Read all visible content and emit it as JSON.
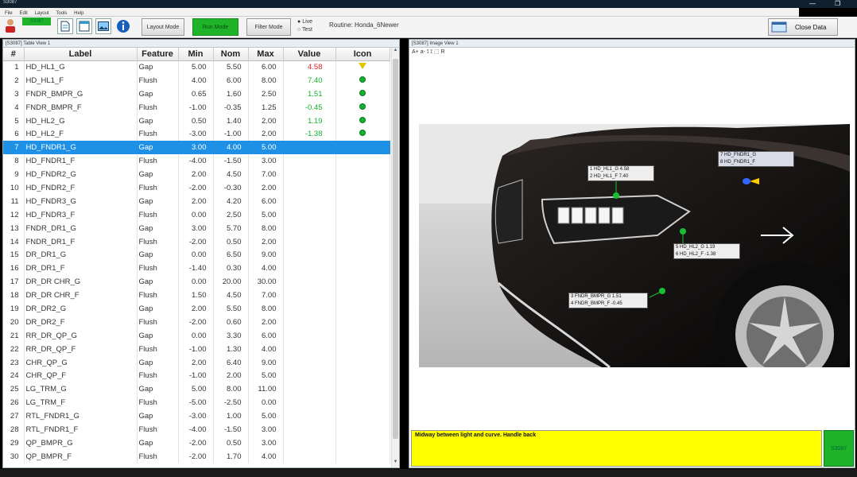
{
  "window": {
    "title": "S3087",
    "menu": [
      "File",
      "Edit",
      "Layout",
      "Tools",
      "Help"
    ]
  },
  "toolbar": {
    "id_badge": "S3087",
    "layout_mode": "Layout Mode",
    "run_mode": "Run Mode",
    "filter_mode": "Filter Mode",
    "radio_live": "Live",
    "radio_test": "Test",
    "routine": "Routine: Honda_6Newer",
    "close_data": "Close Data"
  },
  "table_view": {
    "title": "[S3087] Table View 1",
    "columns": [
      "#",
      "Label",
      "Feature",
      "Min",
      "Nom",
      "Max",
      "Value",
      "Icon"
    ],
    "rows": [
      {
        "n": "1",
        "label": "HD_HL1_G",
        "feature": "Gap",
        "min": "5.00",
        "nom": "5.50",
        "max": "6.00",
        "value": "4.58",
        "value_color": "#e02020",
        "icon": "warn"
      },
      {
        "n": "2",
        "label": "HD_HL1_F",
        "feature": "Flush",
        "min": "4.00",
        "nom": "6.00",
        "max": "8.00",
        "value": "7.40",
        "value_color": "#13b52b",
        "icon": "ok"
      },
      {
        "n": "3",
        "label": "FNDR_BMPR_G",
        "feature": "Gap",
        "min": "0.65",
        "nom": "1.60",
        "max": "2.50",
        "value": "1.51",
        "value_color": "#13b52b",
        "icon": "ok"
      },
      {
        "n": "4",
        "label": "FNDR_BMPR_F",
        "feature": "Flush",
        "min": "-1.00",
        "nom": "-0.35",
        "max": "1.25",
        "value": "-0.45",
        "value_color": "#13b52b",
        "icon": "ok"
      },
      {
        "n": "5",
        "label": "HD_HL2_G",
        "feature": "Gap",
        "min": "0.50",
        "nom": "1.40",
        "max": "2.00",
        "value": "1.19",
        "value_color": "#13b52b",
        "icon": "ok"
      },
      {
        "n": "6",
        "label": "HD_HL2_F",
        "feature": "Flush",
        "min": "-3.00",
        "nom": "-1.00",
        "max": "2.00",
        "value": "-1.38",
        "value_color": "#13b52b",
        "icon": "ok"
      },
      {
        "n": "7",
        "label": "HD_FNDR1_G",
        "feature": "Gap",
        "min": "3.00",
        "nom": "4.00",
        "max": "5.00",
        "value": "",
        "value_color": "",
        "icon": "",
        "selected": true
      },
      {
        "n": "8",
        "label": "HD_FNDR1_F",
        "feature": "Flush",
        "min": "-4.00",
        "nom": "-1.50",
        "max": "3.00",
        "value": "",
        "value_color": "",
        "icon": ""
      },
      {
        "n": "9",
        "label": "HD_FNDR2_G",
        "feature": "Gap",
        "min": "2.00",
        "nom": "4.50",
        "max": "7.00",
        "value": "",
        "value_color": "",
        "icon": ""
      },
      {
        "n": "10",
        "label": "HD_FNDR2_F",
        "feature": "Flush",
        "min": "-2.00",
        "nom": "-0.30",
        "max": "2.00",
        "value": "",
        "value_color": "",
        "icon": ""
      },
      {
        "n": "11",
        "label": "HD_FNDR3_G",
        "feature": "Gap",
        "min": "2.00",
        "nom": "4.20",
        "max": "6.00",
        "value": "",
        "value_color": "",
        "icon": ""
      },
      {
        "n": "12",
        "label": "HD_FNDR3_F",
        "feature": "Flush",
        "min": "0.00",
        "nom": "2.50",
        "max": "5.00",
        "value": "",
        "value_color": "",
        "icon": ""
      },
      {
        "n": "13",
        "label": "FNDR_DR1_G",
        "feature": "Gap",
        "min": "3.00",
        "nom": "5.70",
        "max": "8.00",
        "value": "",
        "value_color": "",
        "icon": ""
      },
      {
        "n": "14",
        "label": "FNDR_DR1_F",
        "feature": "Flush",
        "min": "-2.00",
        "nom": "0.50",
        "max": "2.00",
        "value": "",
        "value_color": "",
        "icon": ""
      },
      {
        "n": "15",
        "label": "DR_DR1_G",
        "feature": "Gap",
        "min": "0.00",
        "nom": "6.50",
        "max": "9.00",
        "value": "",
        "value_color": "",
        "icon": ""
      },
      {
        "n": "16",
        "label": "DR_DR1_F",
        "feature": "Flush",
        "min": "-1.40",
        "nom": "0.30",
        "max": "4.00",
        "value": "",
        "value_color": "",
        "icon": ""
      },
      {
        "n": "17",
        "label": "DR_DR CHR_G",
        "feature": "Gap",
        "min": "0.00",
        "nom": "20.00",
        "max": "30.00",
        "value": "",
        "value_color": "",
        "icon": ""
      },
      {
        "n": "18",
        "label": "DR_DR CHR_F",
        "feature": "Flush",
        "min": "1.50",
        "nom": "4.50",
        "max": "7.00",
        "value": "",
        "value_color": "",
        "icon": ""
      },
      {
        "n": "19",
        "label": "DR_DR2_G",
        "feature": "Gap",
        "min": "2.00",
        "nom": "5.50",
        "max": "8.00",
        "value": "",
        "value_color": "",
        "icon": ""
      },
      {
        "n": "20",
        "label": "DR_DR2_F",
        "feature": "Flush",
        "min": "-2.00",
        "nom": "0.60",
        "max": "2.00",
        "value": "",
        "value_color": "",
        "icon": ""
      },
      {
        "n": "21",
        "label": "RR_DR_QP_G",
        "feature": "Gap",
        "min": "0.00",
        "nom": "3.30",
        "max": "6.00",
        "value": "",
        "value_color": "",
        "icon": ""
      },
      {
        "n": "22",
        "label": "RR_DR_QP_F",
        "feature": "Flush",
        "min": "-1.00",
        "nom": "1.30",
        "max": "4.00",
        "value": "",
        "value_color": "",
        "icon": ""
      },
      {
        "n": "23",
        "label": "CHR_QP_G",
        "feature": "Gap",
        "min": "2.00",
        "nom": "6.40",
        "max": "9.00",
        "value": "",
        "value_color": "",
        "icon": ""
      },
      {
        "n": "24",
        "label": "CHR_QP_F",
        "feature": "Flush",
        "min": "-1.00",
        "nom": "2.00",
        "max": "5.00",
        "value": "",
        "value_color": "",
        "icon": ""
      },
      {
        "n": "25",
        "label": "LG_TRM_G",
        "feature": "Gap",
        "min": "5.00",
        "nom": "8.00",
        "max": "11.00",
        "value": "",
        "value_color": "",
        "icon": ""
      },
      {
        "n": "26",
        "label": "LG_TRM_F",
        "feature": "Flush",
        "min": "-5.00",
        "nom": "-2.50",
        "max": "0.00",
        "value": "",
        "value_color": "",
        "icon": ""
      },
      {
        "n": "27",
        "label": "RTL_FNDR1_G",
        "feature": "Gap",
        "min": "-3.00",
        "nom": "1.00",
        "max": "5.00",
        "value": "",
        "value_color": "",
        "icon": ""
      },
      {
        "n": "28",
        "label": "RTL_FNDR1_F",
        "feature": "Flush",
        "min": "-4.00",
        "nom": "-1.50",
        "max": "3.00",
        "value": "",
        "value_color": "",
        "icon": ""
      },
      {
        "n": "29",
        "label": "QP_BMPR_G",
        "feature": "Gap",
        "min": "-2.00",
        "nom": "0.50",
        "max": "3.00",
        "value": "",
        "value_color": "",
        "icon": ""
      },
      {
        "n": "30",
        "label": "QP_BMPR_F",
        "feature": "Flush",
        "min": "-2.00",
        "nom": "1.70",
        "max": "4.00",
        "value": "",
        "value_color": "",
        "icon": ""
      }
    ]
  },
  "image_view": {
    "title": "[S3087] Image View 1",
    "tools": "A+ a- ⟟ ⟟ ⬚ R",
    "callouts": [
      {
        "line1": "1 HD_HL1_G  4.58",
        "line2": "2 HD_HL1_F  7.40"
      },
      {
        "line1": "5 HD_HL2_G  1.19",
        "line2": "6 HD_HL2_F  -1.38"
      },
      {
        "line1": "3 FNDR_BMPR_G  1.51",
        "line2": "4 FNDR_BMPR_F  -0.45"
      },
      {
        "line1": "7 HD_FNDR1_G",
        "line2": "8 HD_FNDR1_F"
      }
    ],
    "message": "Midway between light and curve.  Handle back",
    "message_badge": "S3087"
  },
  "colors": {
    "run_green": "#1fb32a",
    "selection_blue": "#1e90e6",
    "message_yellow": "#ffff00",
    "fail_red": "#e02020",
    "pass_green": "#13b52b"
  },
  "icons": [
    "user-icon",
    "document-icon",
    "report-icon",
    "image-icon",
    "info-icon",
    "ok-dot-icon",
    "warning-triangle-icon",
    "arrow-right-icon"
  ]
}
